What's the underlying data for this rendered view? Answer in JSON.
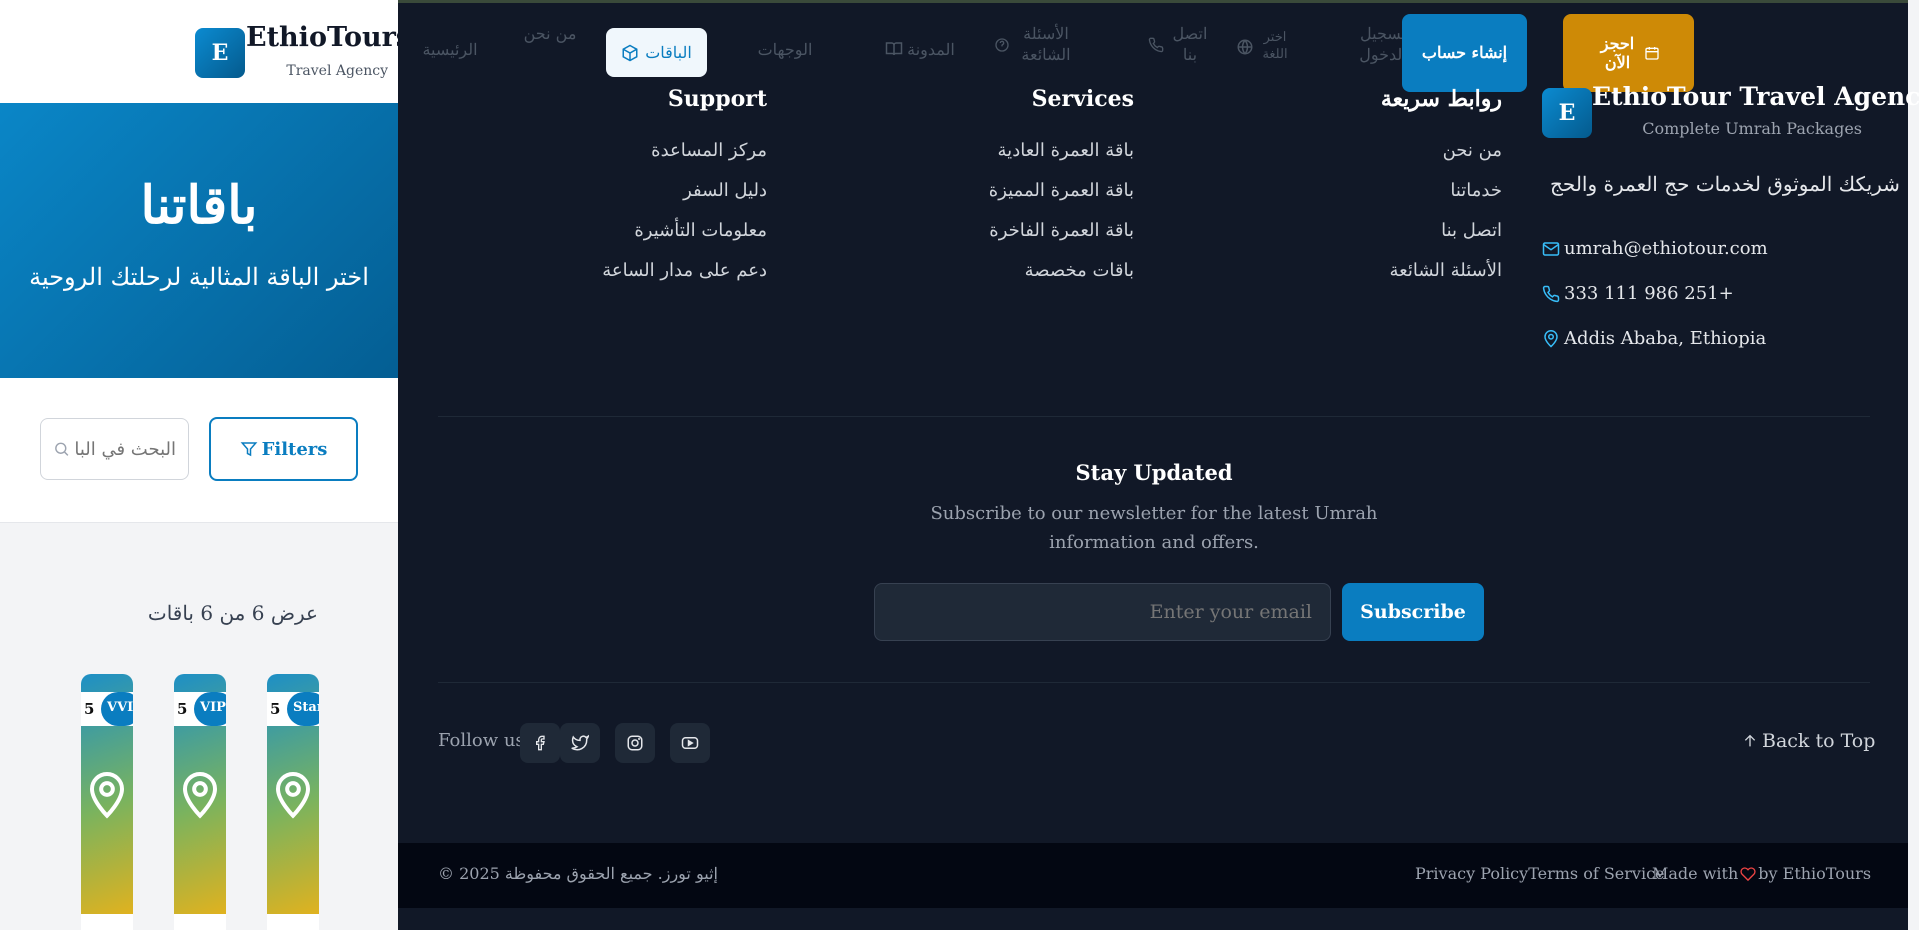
{
  "header": {
    "logo_letter": "E",
    "brand_name": "EthioTours",
    "brand_tagline": "Travel Agency"
  },
  "hero": {
    "title": "باقاتنا",
    "subtitle": "اختر الباقة المثالية لرحلتك الروحية"
  },
  "toolbar": {
    "filters_label": "Filters",
    "search_placeholder": "البحث في الباقات"
  },
  "results": {
    "count_text": "عرض 6 من 6 باقات"
  },
  "cards": [
    {
      "rating": "5",
      "badge": "VVIP"
    },
    {
      "rating": "5",
      "badge": "VIP"
    },
    {
      "rating": "5",
      "badge": "Standard"
    }
  ],
  "nav": {
    "home": "الرئيسية",
    "about": "من نحن",
    "packages": "الباقات",
    "destinations": "الوجهات",
    "blog": "المدونة",
    "faq": "الأسئلة الشائعة",
    "contact": "اتصل بنا",
    "language": "اختر اللغة",
    "login": "تسجيل الدخول",
    "create_account": "إنشاء حساب",
    "book_now": "احجز الآن"
  },
  "footer": {
    "logo_letter": "E",
    "brand": "EthioTour Travel Agency",
    "brand_sub": "Complete Umrah Packages",
    "description": "شريكك الموثوق لخدمات حج العمرة والحج",
    "email": "umrah@ethiotour.com",
    "phone": "+251 986 111 333",
    "address": "Addis Ababa, Ethiopia",
    "quick_links_title": "روابط سريعة",
    "quick_links": [
      "من نحن",
      "خدماتنا",
      "اتصل بنا",
      "الأسئلة الشائعة"
    ],
    "services_title": "Services",
    "services": [
      "باقة العمرة العادية",
      "باقة العمرة المميزة",
      "باقة العمرة الفاخرة",
      "باقات مخصصة"
    ],
    "support_title": "Support",
    "support": [
      "مركز المساعدة",
      "دليل السفر",
      "معلومات التأشيرة",
      "دعم على مدار الساعة"
    ],
    "stay_title": "Stay Updated",
    "stay_desc": "Subscribe to our newsletter for the latest Umrah information and offers.",
    "email_placeholder": "Enter your email",
    "subscribe_label": "Subscribe",
    "follow_label": "Follow us:",
    "back_to_top": "Back to Top",
    "copyright": "© 2025 إثيو تورز. جميع الحقوق محفوظة",
    "privacy": "Privacy Policy",
    "terms": "Terms of Service",
    "made_with": "Made with",
    "made_by": "by EthioTours"
  },
  "colors": {
    "primary": "#0a7dc0",
    "accent": "#ce8a06",
    "dark_bg": "#111827"
  }
}
